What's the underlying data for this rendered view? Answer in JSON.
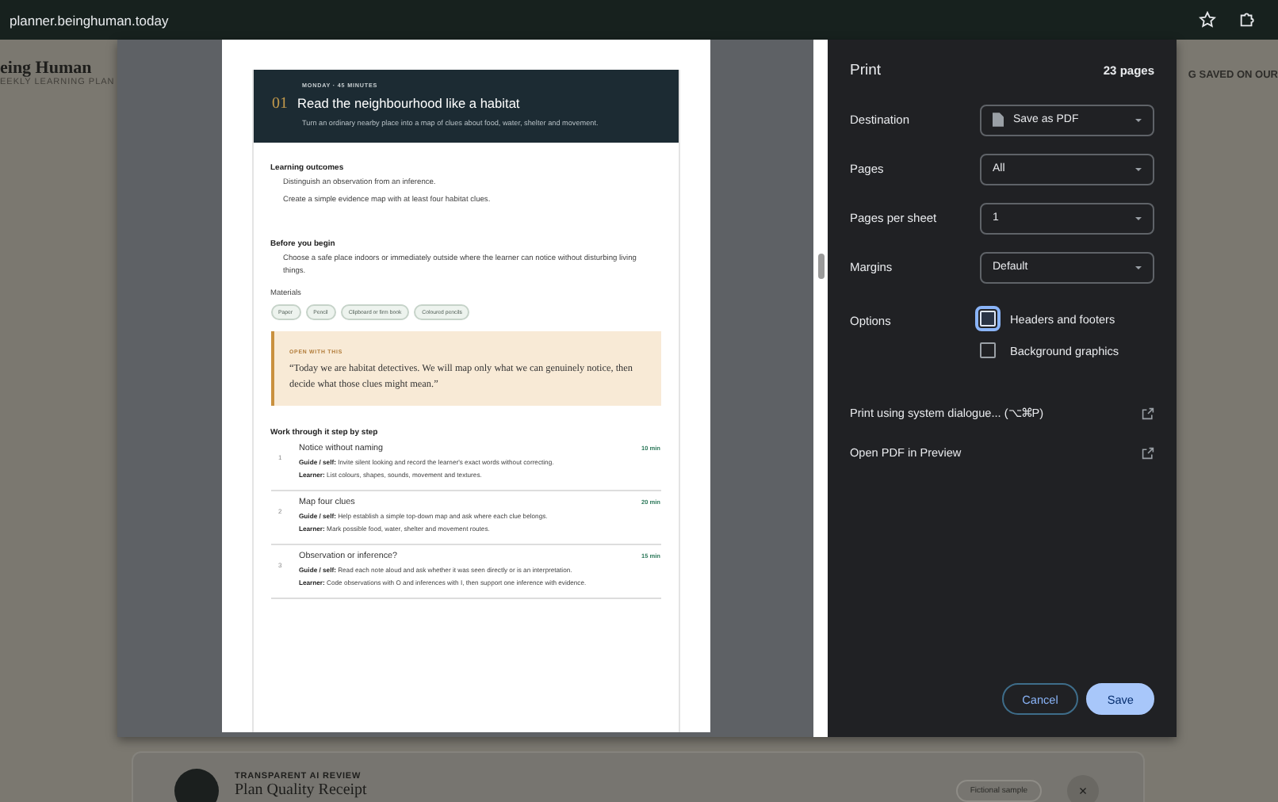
{
  "browser": {
    "url": "planner.beinghuman.today"
  },
  "background_page": {
    "brand_title": "eing Human",
    "brand_subtitle": "EEKLY LEARNING PLAN",
    "banner": "G SAVED ON OUR",
    "card": {
      "eyebrow": "TRANSPARENT AI REVIEW",
      "title": "Plan Quality Receipt",
      "tag": "Fictional sample",
      "close": "×"
    }
  },
  "preview": {
    "eyebrow": "MONDAY · 45 MINUTES",
    "number": "01",
    "title": "Read the neighbourhood like a habitat",
    "subtitle": "Turn an ordinary nearby place into a map of clues about food, water, shelter and movement.",
    "outcomes": {
      "heading": "Learning outcomes",
      "items": [
        "Distinguish an observation from an inference.",
        "Create a simple evidence map with at least four habitat clues."
      ]
    },
    "before": {
      "heading": "Before you begin",
      "text": "Choose a safe place indoors or immediately outside where the learner can notice without disturbing living things."
    },
    "materials": {
      "heading": "Materials",
      "items": [
        "Paper",
        "Pencil",
        "Clipboard or firm book",
        "Coloured pencils"
      ]
    },
    "quote": {
      "label": "OPEN WITH THIS",
      "text": "“Today we are habitat detectives. We will map only what we can genuinely notice, then decide what those clues might mean.”"
    },
    "steps_heading": "Work through it step by step",
    "steps": [
      {
        "number": "1",
        "title": "Notice without naming",
        "duration": "10 min",
        "guide": "**Guide / self:** Invite silent looking and record the learner's exact words without correcting.",
        "learner": "**Learner:** List colours, shapes, sounds, movement and textures."
      },
      {
        "number": "2",
        "title": "Map four clues",
        "duration": "20 min",
        "guide": "**Guide / self:** Help establish a simple top-down map and ask where each clue belongs.",
        "learner": "**Learner:** Mark possible food, water, shelter and movement routes."
      },
      {
        "number": "3",
        "title": "Observation or inference?",
        "duration": "15 min",
        "guide": "**Guide / self:** Read each note aloud and ask whether it was seen directly or is an interpretation.",
        "learner": "**Learner:** Code observations with O and inferences with I, then support one inference with evidence."
      }
    ]
  },
  "print_panel": {
    "title": "Print",
    "page_count": "23 pages",
    "settings": [
      {
        "label": "Destination",
        "value": "Save as PDF",
        "kind": "pdf"
      },
      {
        "label": "Pages",
        "value": "All",
        "kind": "plain"
      },
      {
        "label": "Pages per sheet",
        "value": "1",
        "kind": "plain"
      },
      {
        "label": "Margins",
        "value": "Default",
        "kind": "plain"
      }
    ],
    "options_label": "Options",
    "options": [
      {
        "label": "Headers and footers",
        "checked": false,
        "focused": true
      },
      {
        "label": "Background graphics",
        "checked": false,
        "focused": false
      }
    ],
    "links": [
      {
        "label": "Print using system dialogue... (⌥⌘P)"
      },
      {
        "label": "Open PDF in Preview"
      }
    ],
    "buttons": [
      {
        "label": "Cancel",
        "kind": "secondary"
      },
      {
        "label": "Save",
        "kind": "primary"
      }
    ]
  }
}
